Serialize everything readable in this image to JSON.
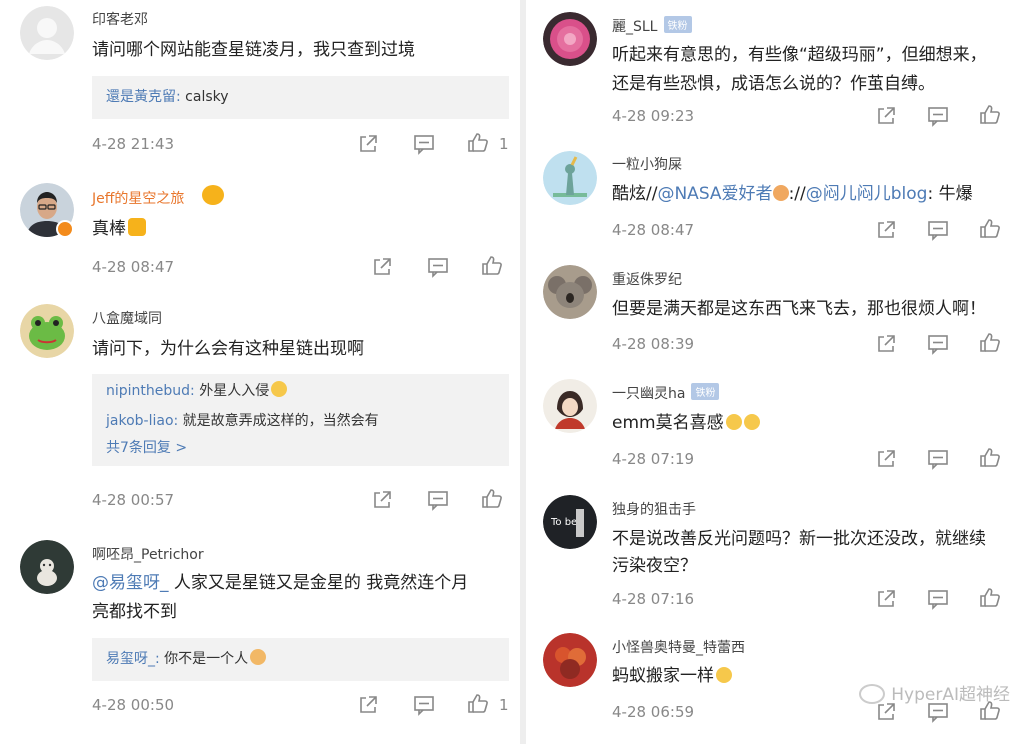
{
  "left": [
    {
      "user": "印客老邓",
      "text": "请问哪个网站能查星链凌月，我只查到过境",
      "replies": [
        {
          "name": "還是黃克留:",
          "text": " calsky"
        }
      ],
      "time": "4-28 21:43",
      "likes": "1"
    },
    {
      "user": "Jeff的星空之旅",
      "text": "真棒",
      "time": "4-28 08:47",
      "likes": ""
    },
    {
      "user": "八盒魔域同",
      "text": "请问下，为什么会有这种星链出现啊",
      "replies": [
        {
          "name": "nipinthebud:",
          "text": " 外星人入侵"
        },
        {
          "name": "jakob-liao:",
          "text": " 就是故意弄成这样的，当然会有"
        }
      ],
      "more": "共7条回复 >",
      "time": "4-28 00:57",
      "likes": ""
    },
    {
      "user": "啊呸昂_Petrichor",
      "mention": "@易玺呀_",
      "text": " 人家又是星链又是金星的 我竟然连个月",
      "text2": "亮都找不到",
      "replies": [
        {
          "name": "易玺呀_:",
          "text": " 你不是一个人"
        }
      ],
      "time": "4-28 00:50",
      "likes": "1"
    }
  ],
  "right": [
    {
      "user": "麗_SLL",
      "badge": "铁粉",
      "text": "听起来有意思的，有些像“超级玛丽”，但细想来，",
      "text2": "还是有些恐惧，成语怎么说的？作茧自缚。",
      "time": "4-28 09:23"
    },
    {
      "user": "一粒小狗屎",
      "text_a": "酷炫//",
      "m1": "@NASA爱好者",
      "text_b": "://",
      "m2": "@闷儿闷儿blog",
      "text_c": ": 牛爆",
      "time": "4-28 08:47"
    },
    {
      "user": "重返侏罗纪",
      "text": "但要是满天都是这东西飞来飞去，那也很烦人啊！",
      "time": "4-28 08:39"
    },
    {
      "user": "一只幽灵ha",
      "badge": "铁粉",
      "text": "emm莫名喜感",
      "time": "4-28 07:19"
    },
    {
      "user": "独身的狙击手",
      "text": "不是说改善反光问题吗？新一批次还没改，就继续",
      "text2": "污染夜空？",
      "time": "4-28 07:16"
    },
    {
      "user": "小怪兽奥特曼_特蕾西",
      "text": "蚂蚁搬家一样",
      "time": "4-28 06:59"
    }
  ],
  "watermark": "HyperAI超神经",
  "colors": {
    "mention": "#4e7bb5",
    "username_vip": "#e8762c",
    "meta": "#888888",
    "reply_bg": "#f2f2f2"
  },
  "icons": [
    "share-icon",
    "comment-icon",
    "like-icon"
  ]
}
